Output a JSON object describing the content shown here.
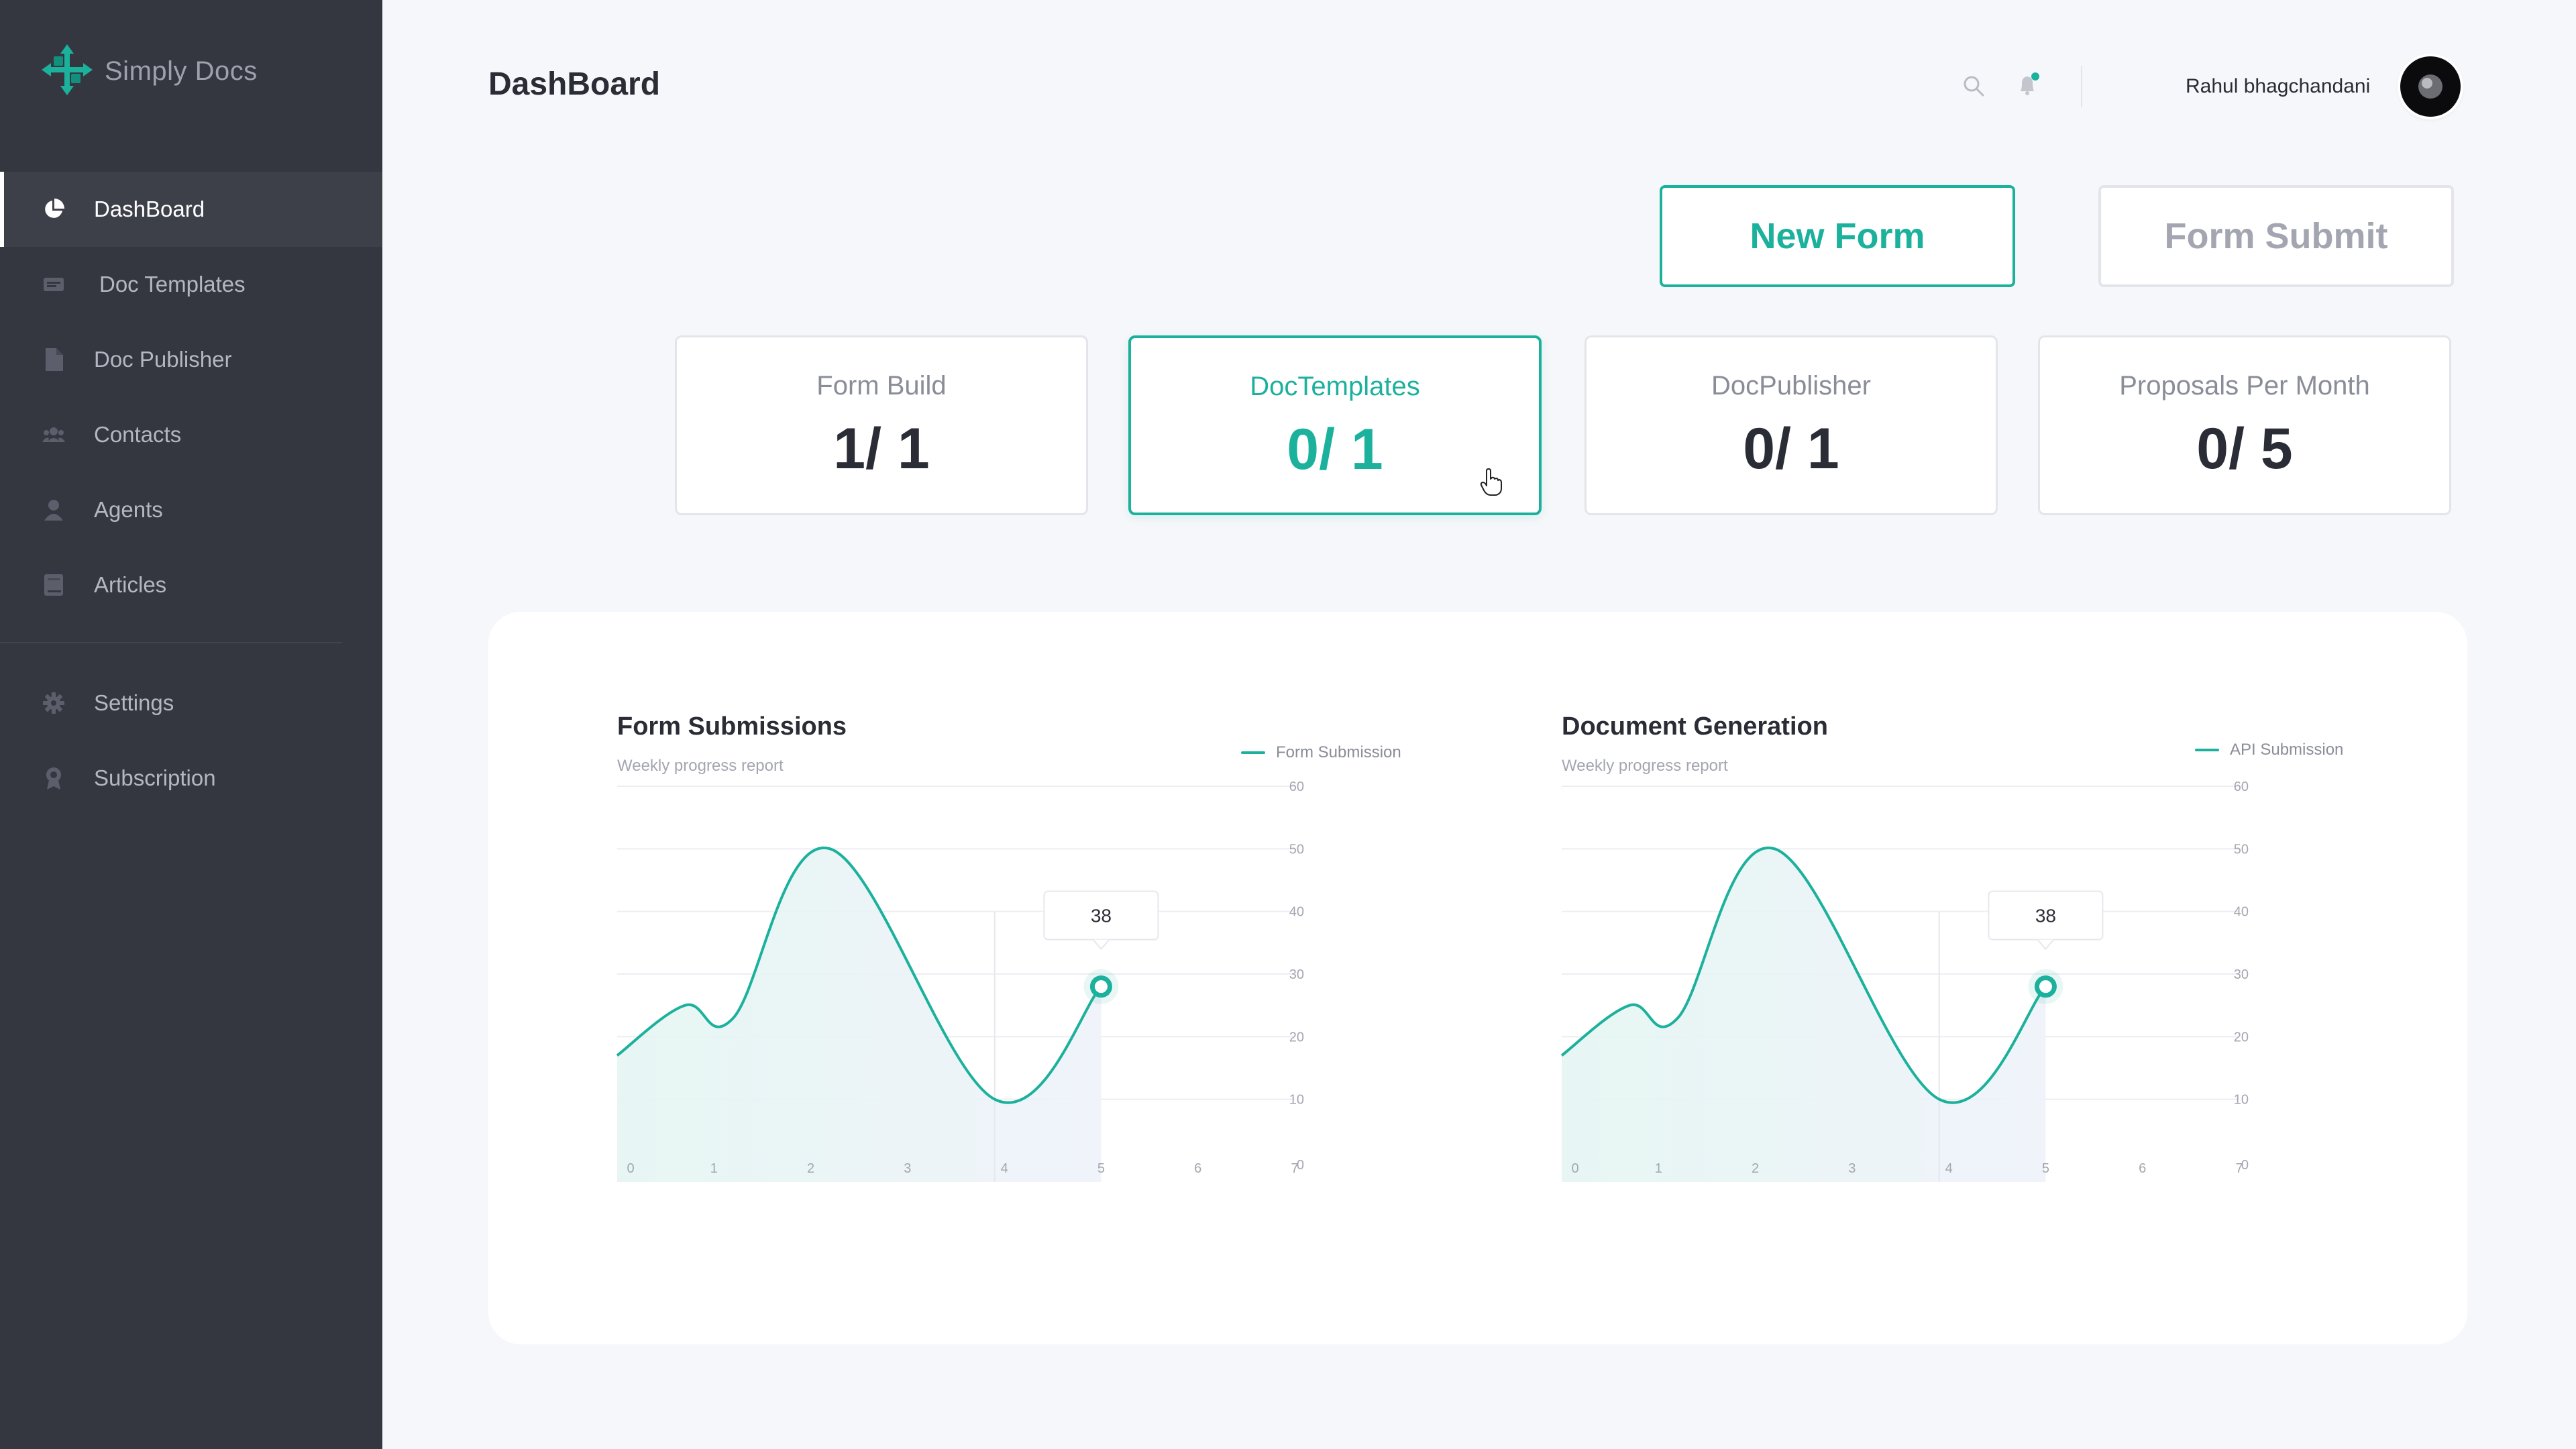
{
  "app": {
    "name": "Simply Docs"
  },
  "sidebar": {
    "items": [
      {
        "label": "DashBoard",
        "icon": "pie-chart-icon",
        "active": true
      },
      {
        "label": "Doc Templates",
        "icon": "template-icon",
        "active": false
      },
      {
        "label": "Doc Publisher",
        "icon": "document-icon",
        "active": false
      },
      {
        "label": "Contacts",
        "icon": "contacts-icon",
        "active": false
      },
      {
        "label": "Agents",
        "icon": "agent-icon",
        "active": false
      },
      {
        "label": "Articles",
        "icon": "book-icon",
        "active": false
      }
    ],
    "bottom_items": [
      {
        "label": "Settings",
        "icon": "gear-icon"
      },
      {
        "label": "Subscription",
        "icon": "badge-icon"
      }
    ]
  },
  "header": {
    "title": "DashBoard",
    "user_name": "Rahul bhagchandani",
    "icons": [
      "search-icon",
      "bell-icon"
    ]
  },
  "actions": {
    "new_form": "New Form",
    "form_submit": "Form Submit"
  },
  "stats": [
    {
      "label": "Form Build",
      "value": "1/ 1",
      "selected": false
    },
    {
      "label": "DocTemplates",
      "value": "0/ 1",
      "selected": true
    },
    {
      "label": "DocPublisher",
      "value": "0/ 1",
      "selected": false
    },
    {
      "label": "Proposals Per Month",
      "value": "0/ 5",
      "selected": false
    }
  ],
  "colors": {
    "accent": "#1bb19c",
    "sidebar_bg": "#353740",
    "page_bg": "#f6f7fa"
  },
  "charts": [
    {
      "title": "Form Submissions",
      "subtitle": "Weekly progress report",
      "legend": "Form Submission",
      "tooltip": "38"
    },
    {
      "title": "Document Generation",
      "subtitle": "Weekly progress report",
      "legend": "API Submission",
      "tooltip": "38"
    }
  ],
  "chart_data": [
    {
      "type": "area",
      "title": "Form Submissions",
      "subtitle": "Weekly progress report",
      "x": [
        0,
        0.7,
        1.2,
        2.2,
        3.9,
        5.0
      ],
      "series": [
        {
          "name": "Form Submission",
          "values": [
            17,
            25,
            23,
            50,
            10,
            28
          ]
        }
      ],
      "x_ticks": [
        0,
        1,
        2,
        3,
        4,
        5,
        6,
        7
      ],
      "y_ticks": [
        0,
        10,
        20,
        30,
        40,
        50,
        60
      ],
      "xlim": [
        0,
        7
      ],
      "ylim": [
        0,
        60
      ],
      "highlight": {
        "x": 5.0,
        "label": "38"
      },
      "legend_position": "top-right",
      "grid": true
    },
    {
      "type": "area",
      "title": "Document Generation",
      "subtitle": "Weekly progress report",
      "x": [
        0,
        0.7,
        1.2,
        2.2,
        3.9,
        5.0
      ],
      "series": [
        {
          "name": "API Submission",
          "values": [
            17,
            25,
            23,
            50,
            10,
            28
          ]
        }
      ],
      "x_ticks": [
        0,
        1,
        2,
        3,
        4,
        5,
        6,
        7
      ],
      "y_ticks": [
        0,
        10,
        20,
        30,
        40,
        50,
        60
      ],
      "xlim": [
        0,
        7
      ],
      "ylim": [
        0,
        60
      ],
      "highlight": {
        "x": 5.0,
        "label": "38"
      },
      "legend_position": "top-right",
      "grid": true
    }
  ]
}
